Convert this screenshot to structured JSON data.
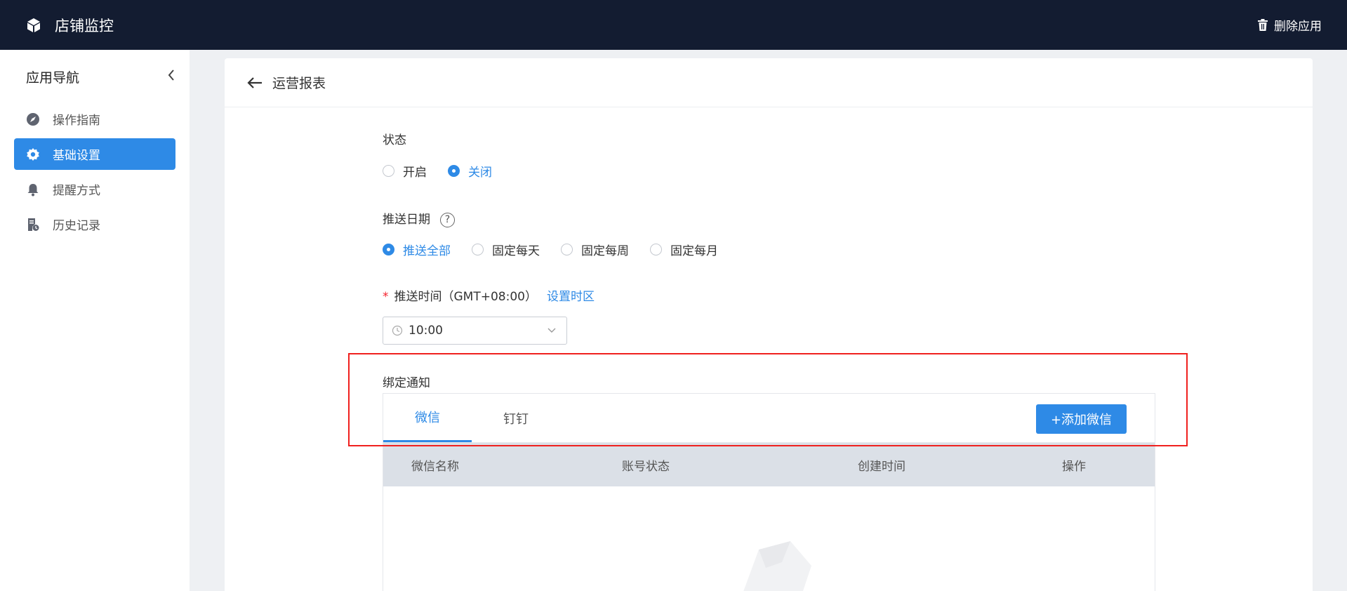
{
  "header": {
    "app_title": "店铺监控",
    "delete_label": "删除应用"
  },
  "sidebar": {
    "title": "应用导航",
    "items": [
      {
        "label": "操作指南",
        "icon": "compass-icon",
        "active": false
      },
      {
        "label": "基础设置",
        "icon": "gear-icon",
        "active": true
      },
      {
        "label": "提醒方式",
        "icon": "bell-icon",
        "active": false
      },
      {
        "label": "历史记录",
        "icon": "history-doc-icon",
        "active": false
      }
    ]
  },
  "page": {
    "title": "运营报表"
  },
  "form": {
    "status": {
      "label": "状态",
      "options": [
        "开启",
        "关闭"
      ],
      "selected": "关闭"
    },
    "push_date": {
      "label": "推送日期",
      "options": [
        "推送全部",
        "固定每天",
        "固定每周",
        "固定每月"
      ],
      "selected": "推送全部"
    },
    "push_time": {
      "required_mark": "*",
      "label": "推送时间（GMT+08:00）",
      "timezone_link": "设置时区",
      "value": "10:00"
    },
    "bind_notify": {
      "label": "绑定通知",
      "tabs": [
        "微信",
        "钉钉"
      ],
      "active_tab": "微信",
      "add_button": "+添加微信",
      "columns": [
        "微信名称",
        "账号状态",
        "创建时间",
        "操作"
      ]
    }
  },
  "colors": {
    "topbar": "#131c31",
    "accent": "#2e8ae6",
    "highlight": "#f0201e"
  }
}
